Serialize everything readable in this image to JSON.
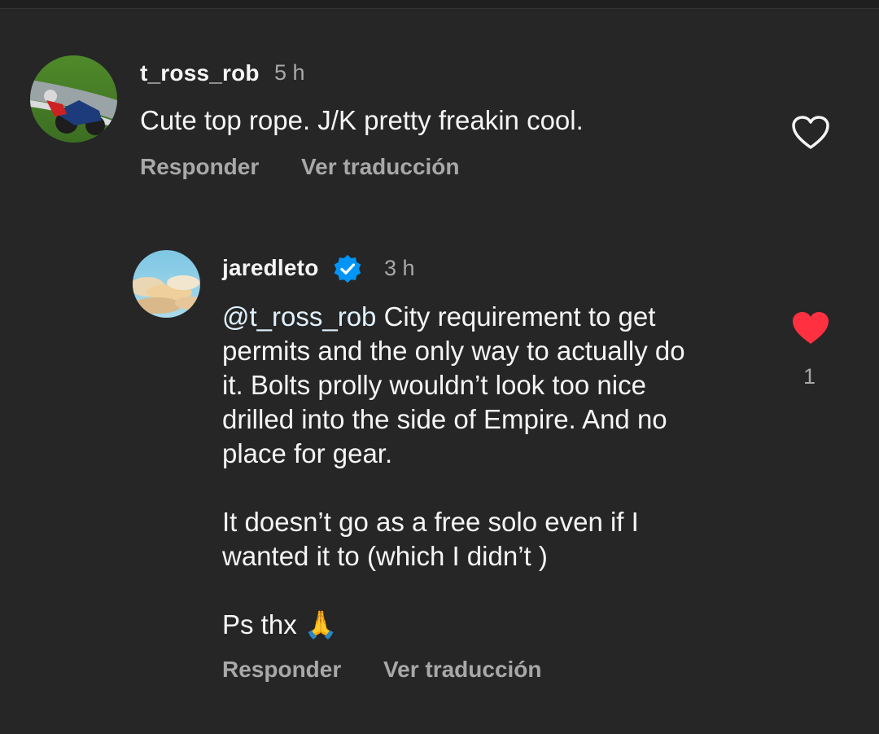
{
  "comments": [
    {
      "username": "t_ross_rob",
      "time": "5 h",
      "text": "Cute top rope. J/K pretty freakin cool.",
      "reply_label": "Responder",
      "translate_label": "Ver traducción",
      "liked": false,
      "avatar_icon": "motorcycle-racer-photo"
    },
    {
      "username": "jaredleto",
      "verified": true,
      "time": "3 h",
      "mention": "@t_ross_rob",
      "text": " City requirement to get\npermits and the only way to actually do\nit. Bolts prolly wouldn’t look too nice\ndrilled into the side of Empire. And no\nplace for gear.\n\nIt doesn’t go as a free solo even if I\nwanted it to (which I didn’t )\n\nPs thx 🙏",
      "reply_label": "Responder",
      "translate_label": "Ver traducción",
      "liked": true,
      "like_count": "1",
      "avatar_icon": "sky-clouds-photo"
    }
  ],
  "colors": {
    "background": "#262626",
    "primary_text": "#f5f5f5",
    "secondary_text": "#a8a8a8",
    "like_red": "#ff3040",
    "verified_blue": "#0095f6",
    "mention": "#e0f1ff"
  }
}
